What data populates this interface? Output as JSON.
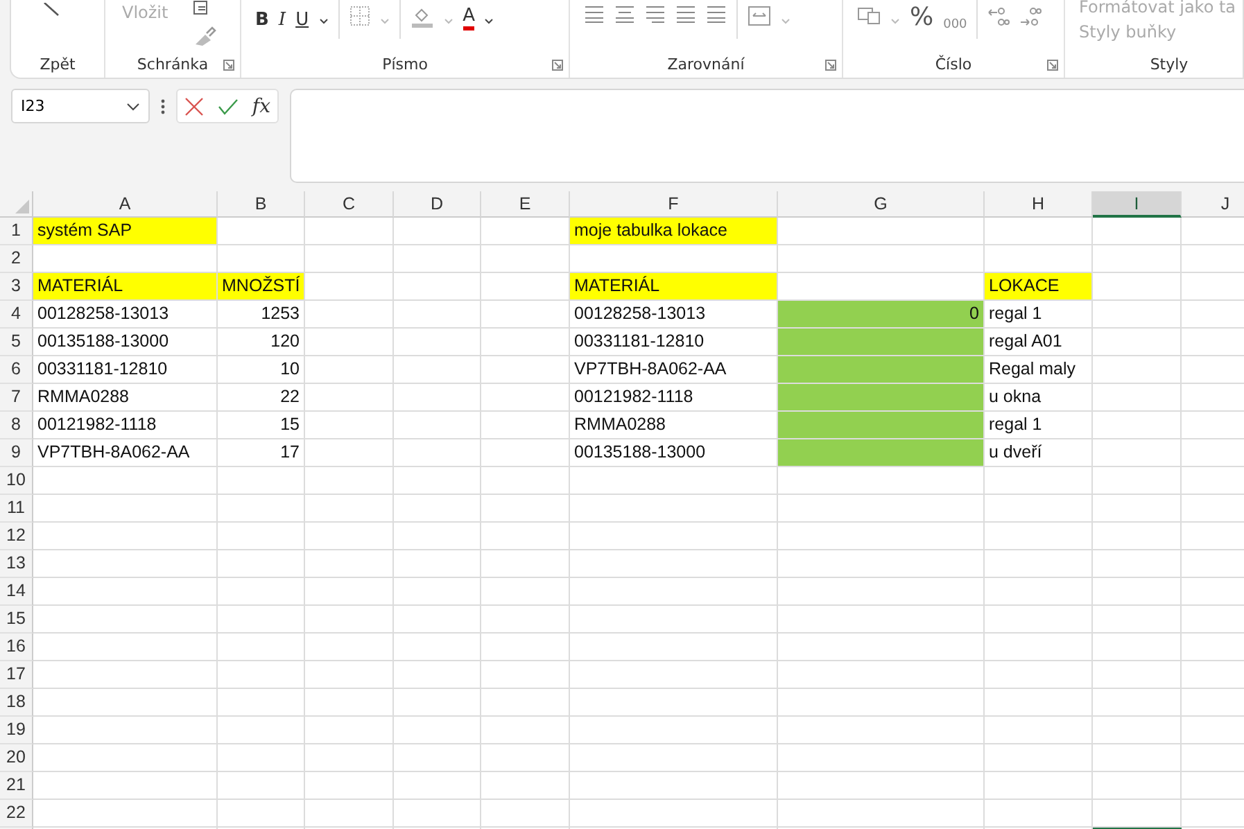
{
  "ribbon": {
    "groups": [
      {
        "kind": "undo",
        "label": "Zpět",
        "dialog": false
      },
      {
        "kind": "clipboard",
        "label": "Schránka",
        "dialog": true,
        "paste": "Vložit"
      },
      {
        "kind": "font",
        "label": "Písmo",
        "dialog": true,
        "bold": "B",
        "italic": "I",
        "underline": "U",
        "font_color": "A"
      },
      {
        "kind": "align",
        "label": "Zarovnání",
        "dialog": true
      },
      {
        "kind": "number",
        "label": "Číslo",
        "dialog": true,
        "percent": "%",
        "thousands": "000"
      },
      {
        "kind": "styles",
        "label": "Styly",
        "dialog": false,
        "format_table": "Formátovat jako ta",
        "cell_styles": "Styly buňky"
      }
    ]
  },
  "formula_bar": {
    "name_box": "I23",
    "fx": "fx"
  },
  "sheet": {
    "columns": [
      {
        "label": "A",
        "selected": false
      },
      {
        "label": "B",
        "selected": false
      },
      {
        "label": "C",
        "selected": false
      },
      {
        "label": "D",
        "selected": false
      },
      {
        "label": "E",
        "selected": false
      },
      {
        "label": "F",
        "selected": false
      },
      {
        "label": "G",
        "selected": false
      },
      {
        "label": "H",
        "selected": false
      },
      {
        "label": "I",
        "selected": true
      },
      {
        "label": "J",
        "selected": false
      }
    ],
    "rows": [
      {
        "number": "1",
        "cells": [
          {
            "text": "systém SAP",
            "kind": "text",
            "color": "#ffff00"
          },
          null,
          null,
          null,
          null,
          {
            "text": "moje tabulka lokace",
            "kind": "text",
            "color": "#ffff00"
          },
          null,
          null,
          null,
          null
        ]
      },
      {
        "number": "2",
        "cells": [
          null,
          null,
          null,
          null,
          null,
          null,
          null,
          null,
          null,
          null
        ]
      },
      {
        "number": "3",
        "cells": [
          {
            "text": "MATERIÁL",
            "kind": "text",
            "color": "#ffff00"
          },
          {
            "text": "MNOŽSTÍ",
            "kind": "text",
            "color": "#ffff00"
          },
          null,
          null,
          null,
          {
            "text": "MATERIÁL",
            "kind": "text",
            "color": "#ffff00"
          },
          null,
          {
            "text": "LOKACE",
            "kind": "text",
            "color": "#ffff00"
          },
          null,
          null
        ]
      },
      {
        "number": "4",
        "cells": [
          {
            "text": "00128258-13013",
            "kind": "text"
          },
          {
            "text": "1253",
            "kind": "number"
          },
          null,
          null,
          null,
          {
            "text": "00128258-13013",
            "kind": "text"
          },
          {
            "text": "0",
            "kind": "number",
            "color": "#92d050"
          },
          {
            "text": "regal 1",
            "kind": "text"
          },
          null,
          null
        ]
      },
      {
        "number": "5",
        "cells": [
          {
            "text": "00135188-13000",
            "kind": "text"
          },
          {
            "text": "120",
            "kind": "number"
          },
          null,
          null,
          null,
          {
            "text": "00331181-12810",
            "kind": "text"
          },
          {
            "kind": "text",
            "color": "#92d050"
          },
          {
            "text": "regal A01",
            "kind": "text"
          },
          null,
          null
        ]
      },
      {
        "number": "6",
        "cells": [
          {
            "text": "00331181-12810",
            "kind": "text"
          },
          {
            "text": "10",
            "kind": "number"
          },
          null,
          null,
          null,
          {
            "text": "VP7TBH-8A062-AA",
            "kind": "text"
          },
          {
            "kind": "text",
            "color": "#92d050"
          },
          {
            "text": "Regal maly",
            "kind": "text"
          },
          null,
          null
        ]
      },
      {
        "number": "7",
        "cells": [
          {
            "text": "RMMA0288",
            "kind": "text"
          },
          {
            "text": "22",
            "kind": "number"
          },
          null,
          null,
          null,
          {
            "text": "00121982-1118",
            "kind": "text"
          },
          {
            "kind": "text",
            "color": "#92d050"
          },
          {
            "text": "u okna",
            "kind": "text"
          },
          null,
          null
        ]
      },
      {
        "number": "8",
        "cells": [
          {
            "text": "00121982-1118",
            "kind": "text"
          },
          {
            "text": "15",
            "kind": "number"
          },
          null,
          null,
          null,
          {
            "text": "RMMA0288",
            "kind": "text"
          },
          {
            "kind": "text",
            "color": "#92d050"
          },
          {
            "text": "regal 1",
            "kind": "text"
          },
          null,
          null
        ]
      },
      {
        "number": "9",
        "cells": [
          {
            "text": "VP7TBH-8A062-AA",
            "kind": "text"
          },
          {
            "text": "17",
            "kind": "number"
          },
          null,
          null,
          null,
          {
            "text": "00135188-13000",
            "kind": "text"
          },
          {
            "kind": "text",
            "color": "#92d050"
          },
          {
            "text": "u dveří",
            "kind": "text"
          },
          null,
          null
        ]
      },
      {
        "number": "10",
        "cells": [
          null,
          null,
          null,
          null,
          null,
          null,
          null,
          null,
          null,
          null
        ]
      },
      {
        "number": "11",
        "cells": [
          null,
          null,
          null,
          null,
          null,
          null,
          null,
          null,
          null,
          null
        ]
      },
      {
        "number": "12",
        "cells": [
          null,
          null,
          null,
          null,
          null,
          null,
          null,
          null,
          null,
          null
        ]
      },
      {
        "number": "13",
        "cells": [
          null,
          null,
          null,
          null,
          null,
          null,
          null,
          null,
          null,
          null
        ]
      },
      {
        "number": "14",
        "cells": [
          null,
          null,
          null,
          null,
          null,
          null,
          null,
          null,
          null,
          null
        ]
      },
      {
        "number": "15",
        "cells": [
          null,
          null,
          null,
          null,
          null,
          null,
          null,
          null,
          null,
          null
        ]
      },
      {
        "number": "16",
        "cells": [
          null,
          null,
          null,
          null,
          null,
          null,
          null,
          null,
          null,
          null
        ]
      },
      {
        "number": "17",
        "cells": [
          null,
          null,
          null,
          null,
          null,
          null,
          null,
          null,
          null,
          null
        ]
      },
      {
        "number": "18",
        "cells": [
          null,
          null,
          null,
          null,
          null,
          null,
          null,
          null,
          null,
          null
        ]
      },
      {
        "number": "19",
        "cells": [
          null,
          null,
          null,
          null,
          null,
          null,
          null,
          null,
          null,
          null
        ]
      },
      {
        "number": "20",
        "cells": [
          null,
          null,
          null,
          null,
          null,
          null,
          null,
          null,
          null,
          null
        ]
      },
      {
        "number": "21",
        "cells": [
          null,
          null,
          null,
          null,
          null,
          null,
          null,
          null,
          null,
          null
        ]
      },
      {
        "number": "22",
        "cells": [
          null,
          null,
          null,
          null,
          null,
          null,
          null,
          null,
          null,
          null
        ]
      }
    ]
  }
}
